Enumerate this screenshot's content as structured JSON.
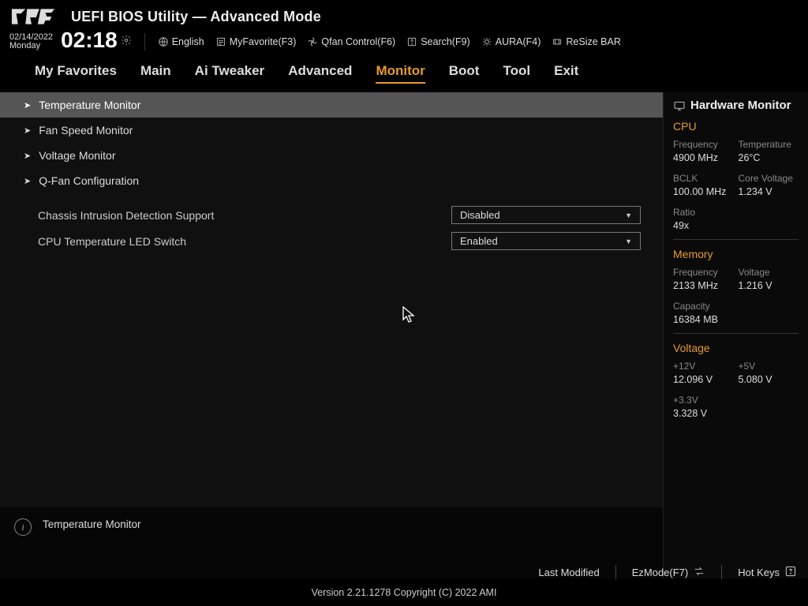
{
  "header": {
    "title": "UEFI BIOS Utility — Advanced Mode",
    "date": "02/14/2022",
    "day": "Monday",
    "time": "02:18",
    "toolbar": {
      "language": "English",
      "fav": "MyFavorite(F3)",
      "qfan": "Qfan Control(F6)",
      "search": "Search(F9)",
      "aura": "AURA(F4)",
      "resize": "ReSize BAR"
    }
  },
  "tabs": [
    "My Favorites",
    "Main",
    "Ai Tweaker",
    "Advanced",
    "Monitor",
    "Boot",
    "Tool",
    "Exit"
  ],
  "active_tab": "Monitor",
  "menu": {
    "items": [
      "Temperature Monitor",
      "Fan Speed Monitor",
      "Voltage Monitor",
      "Q-Fan Configuration"
    ],
    "selected": "Temperature Monitor"
  },
  "settings": [
    {
      "label": "Chassis Intrusion Detection Support",
      "value": "Disabled"
    },
    {
      "label": "CPU Temperature LED Switch",
      "value": "Enabled"
    }
  ],
  "help": {
    "text": "Temperature Monitor"
  },
  "hw": {
    "title": "Hardware Monitor",
    "cpu": {
      "heading": "CPU",
      "freq_label": "Frequency",
      "freq": "4900 MHz",
      "temp_label": "Temperature",
      "temp": "26°C",
      "bclk_label": "BCLK",
      "bclk": "100.00 MHz",
      "vcore_label": "Core Voltage",
      "vcore": "1.234 V",
      "ratio_label": "Ratio",
      "ratio": "49x"
    },
    "mem": {
      "heading": "Memory",
      "freq_label": "Frequency",
      "freq": "2133 MHz",
      "volt_label": "Voltage",
      "volt": "1.216 V",
      "cap_label": "Capacity",
      "cap": "16384 MB"
    },
    "volt": {
      "heading": "Voltage",
      "v12_label": "+12V",
      "v12": "12.096 V",
      "v5_label": "+5V",
      "v5": "5.080 V",
      "v33_label": "+3.3V",
      "v33": "3.328 V"
    }
  },
  "footer": {
    "last_mod": "Last Modified",
    "ezmode": "EzMode(F7)",
    "hotkeys": "Hot Keys",
    "copyright": "Version 2.21.1278 Copyright (C) 2022 AMI"
  }
}
